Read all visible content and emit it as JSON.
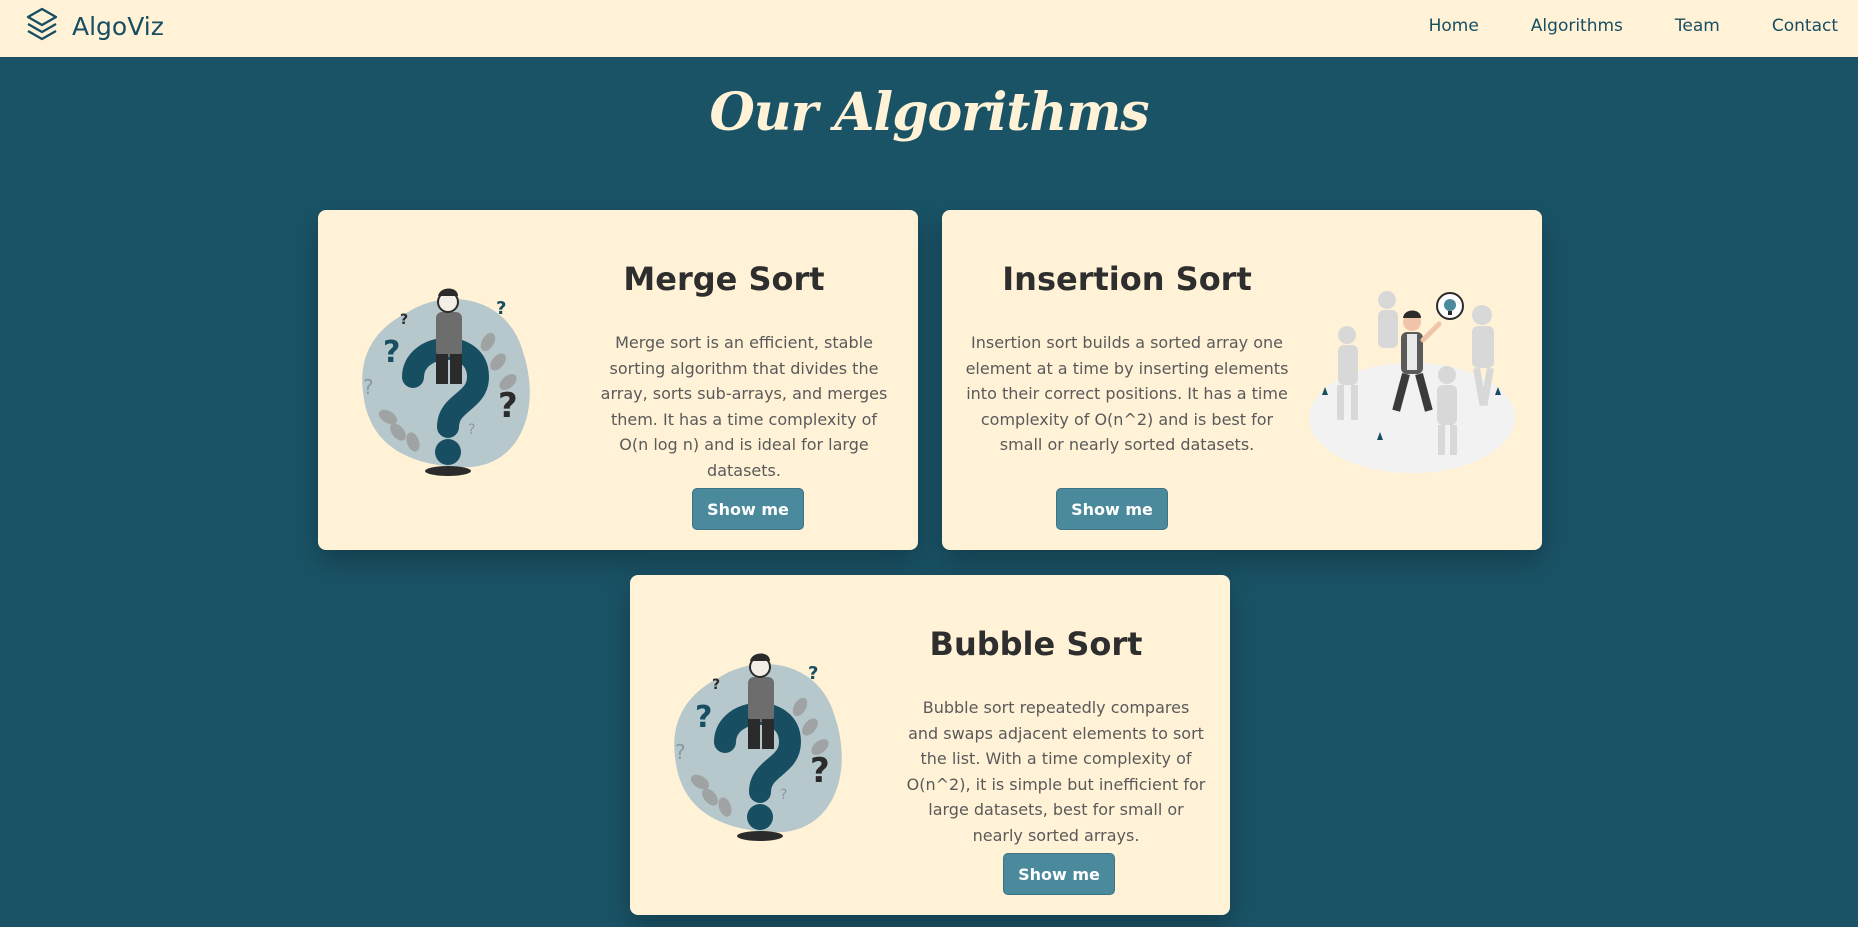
{
  "nav": {
    "brand": "AlgoViz",
    "links": [
      "Home",
      "Algorithms",
      "Team",
      "Contact"
    ]
  },
  "page": {
    "title": "Our Algorithms"
  },
  "cards": [
    {
      "title": "Merge Sort",
      "description": "Merge sort is an efficient, stable sorting algorithm that divides the array, sorts sub-arrays, and merges them. It has a time complexity of O(n log n) and is ideal for large datasets.",
      "button": "Show me",
      "illustration": "question-person-illustration"
    },
    {
      "title": "Insertion Sort",
      "description": "Insertion sort builds a sorted array one element at a time by inserting elements into their correct positions. It has a time complexity of O(n^2) and is best for small or nearly sorted datasets.",
      "button": "Show me",
      "illustration": "walking-people-illustration"
    },
    {
      "title": "Bubble Sort",
      "description": "Bubble sort repeatedly compares and swaps adjacent elements to sort the list. With a time complexity of O(n^2), it is simple but inefficient for large datasets, best for small or nearly sorted arrays.",
      "button": "Show me",
      "illustration": "question-person-illustration"
    }
  ],
  "colors": {
    "background": "#1a5366",
    "cream": "#fff2d7",
    "button": "#4a8a9c",
    "brand": "#184e62"
  }
}
